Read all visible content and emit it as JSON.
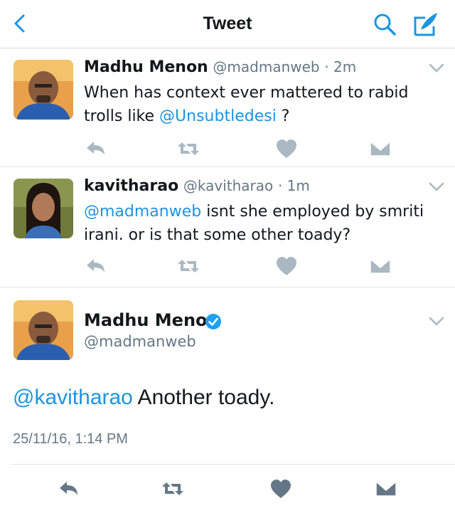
{
  "header": {
    "title": "Tweet",
    "icons": {
      "back": "chevron-left-icon",
      "search": "search-icon",
      "compose": "compose-icon"
    },
    "accent": "#1b95e0"
  },
  "replies": [
    {
      "name": "Madhu Menon",
      "handle": "@madmanweb",
      "time": "· 2m",
      "text_before": "When has context ever mattered to rabid trolls like ",
      "mention": "@Unsubtledesi",
      "text_after": " ?"
    },
    {
      "name": "kavitharao",
      "handle": "@kavitharao",
      "time": "· 1m",
      "mention": "@madmanweb",
      "text_after": " isnt she employed by smriti irani. or is that some other toady?"
    }
  ],
  "main_tweet": {
    "name": "Madhu Menon",
    "handle": "@madmanweb",
    "verified": true,
    "mention": "@kavitharao",
    "text_after": " Another toady.",
    "timestamp": "25/11/16, 1:14 PM"
  },
  "colors": {
    "mention": "#1b95e0",
    "icon_gray": "#aab8c2",
    "icon_dark": "#657786",
    "verified": "#1da1f2"
  }
}
